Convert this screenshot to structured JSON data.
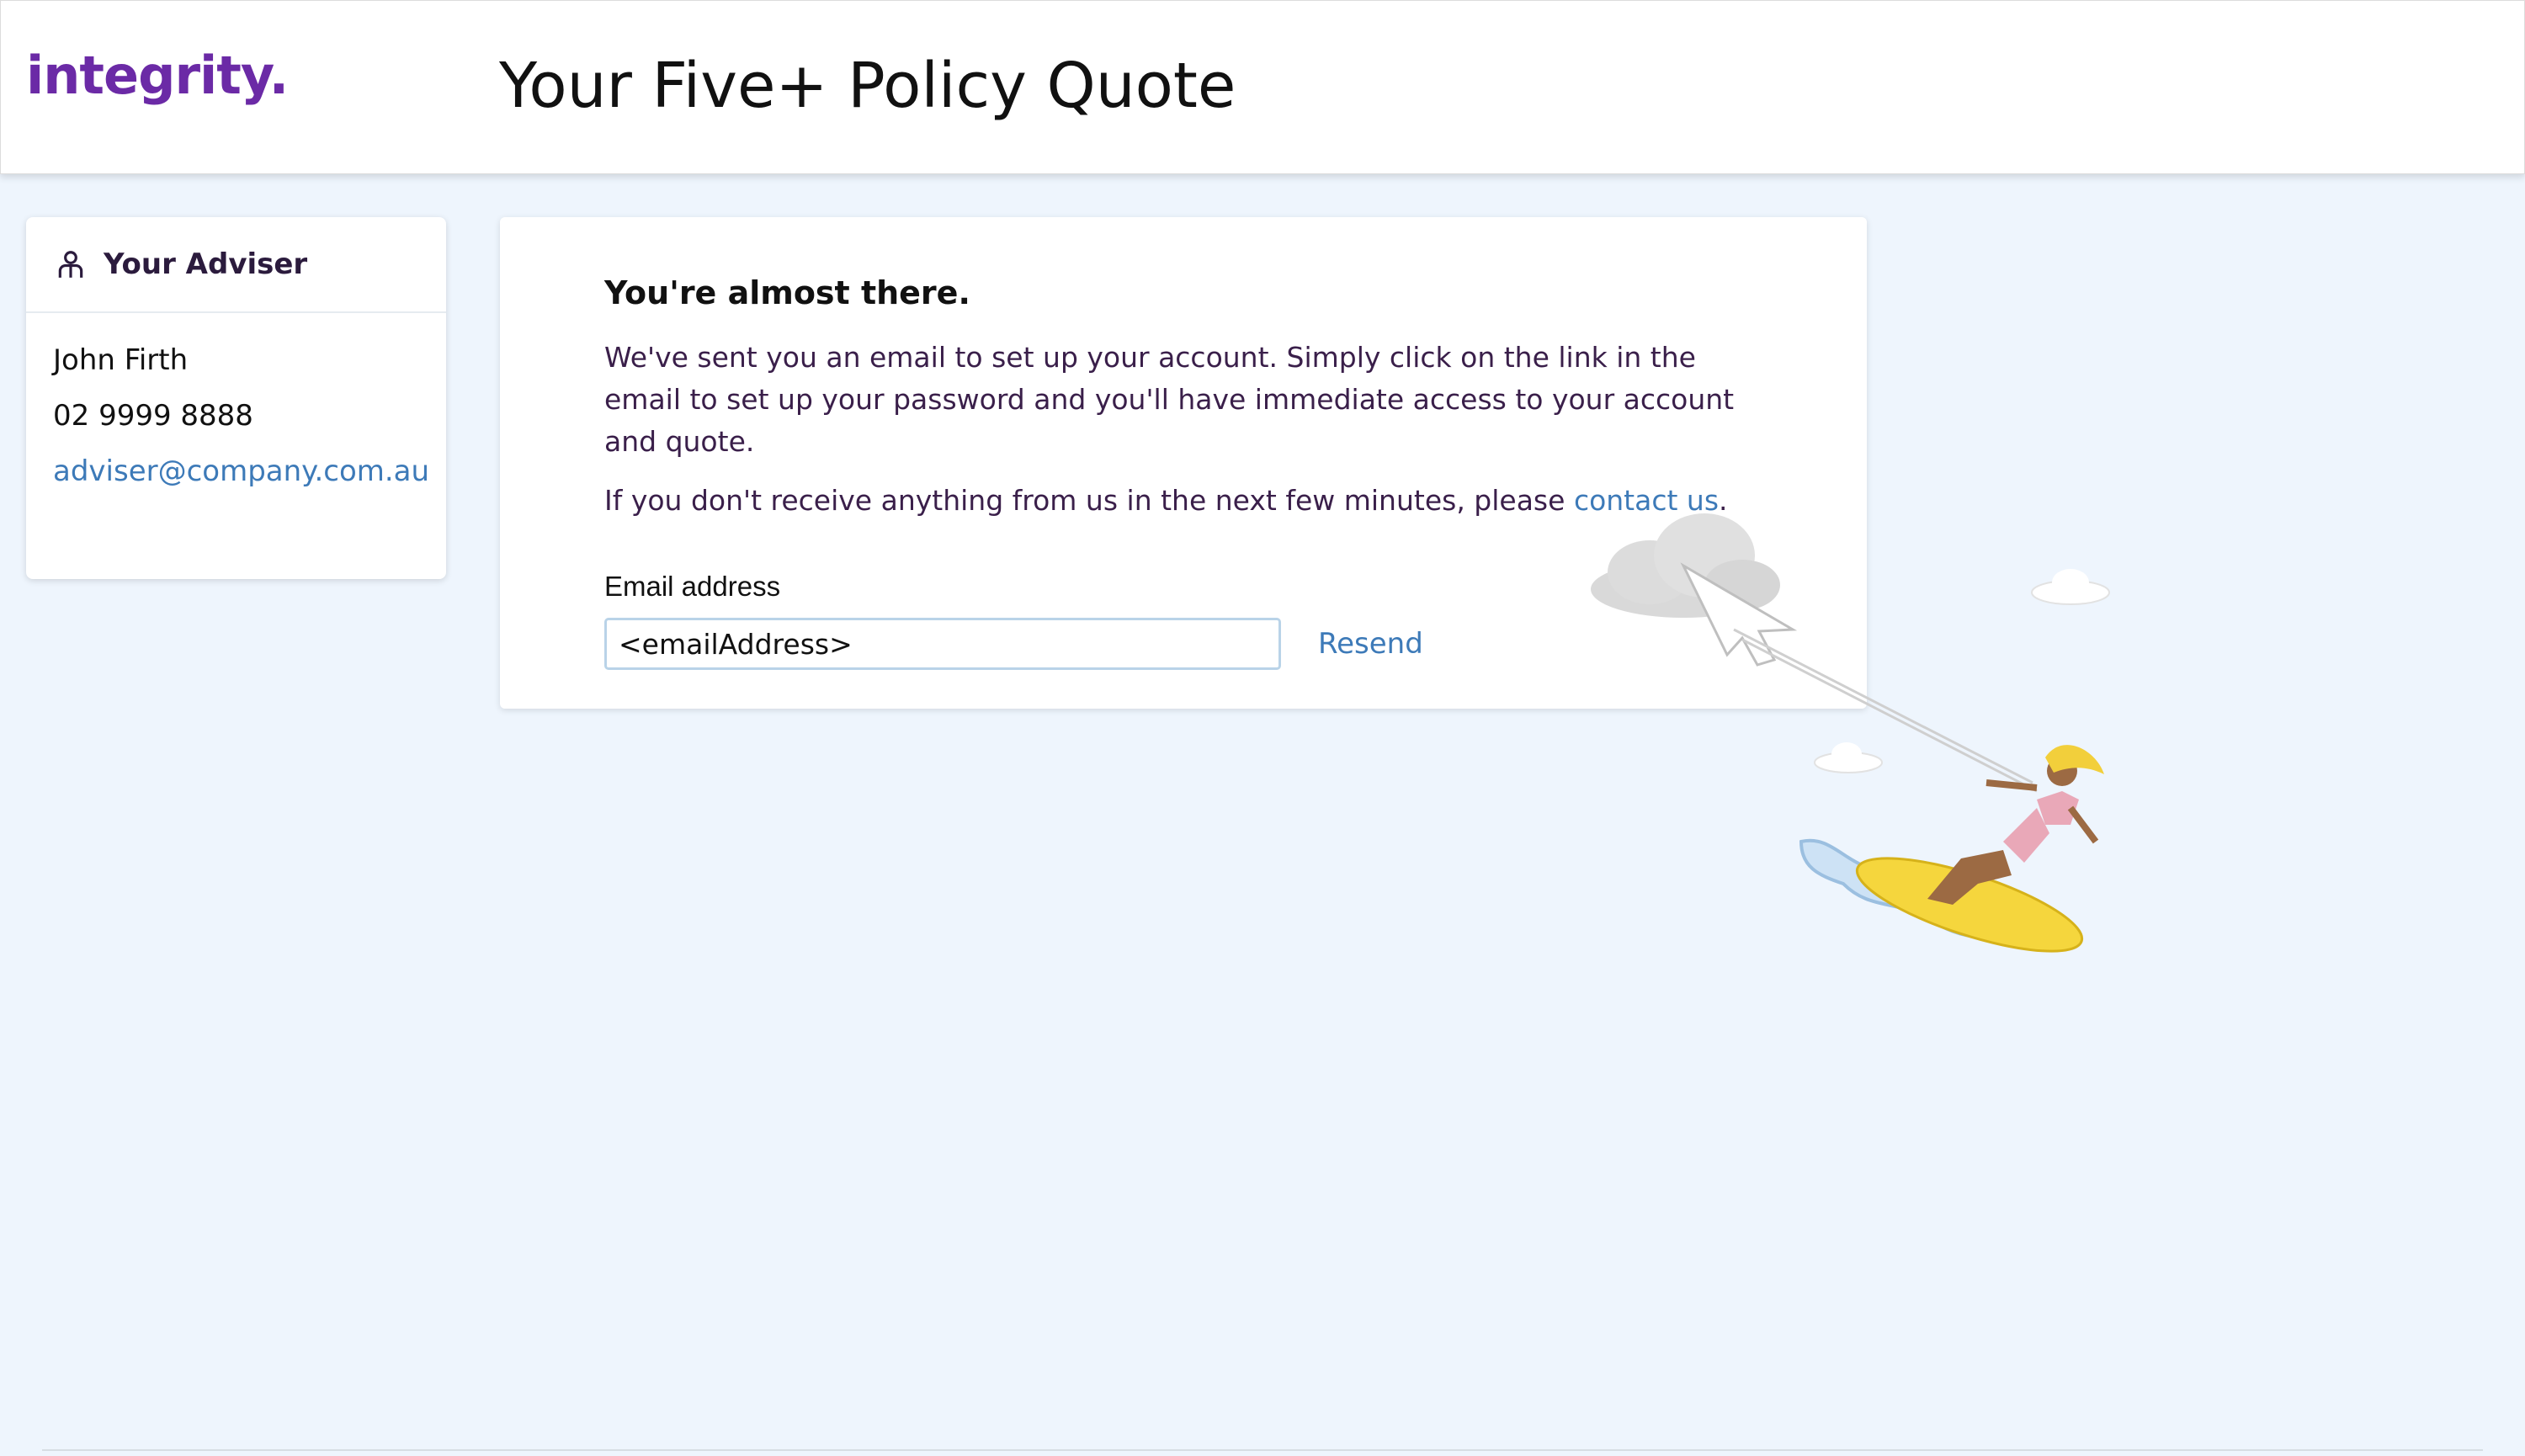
{
  "header": {
    "logo": "integrity.",
    "title": "Your Five+ Policy Quote"
  },
  "adviser": {
    "heading": "Your Adviser",
    "icon": "person-icon",
    "name": "John Firth",
    "phone": "02 9999 8888",
    "email": "adviser@company.com.au"
  },
  "main": {
    "headline": "You're almost there.",
    "paragraph1": "We've sent you an email to set up your account. Simply click on the link in the email to set up your password and you'll have immediate access to your account and quote.",
    "paragraph2_prefix": "If you don't receive anything from us in the next few minutes, please ",
    "contact_link": "contact us",
    "paragraph2_suffix": ".",
    "email_label": "Email address",
    "email_value": "<emailAddress>",
    "resend_label": "Resend"
  },
  "colors": {
    "brand": "#6b2aa6",
    "link": "#3d7ab8",
    "background": "#eef5fd"
  }
}
